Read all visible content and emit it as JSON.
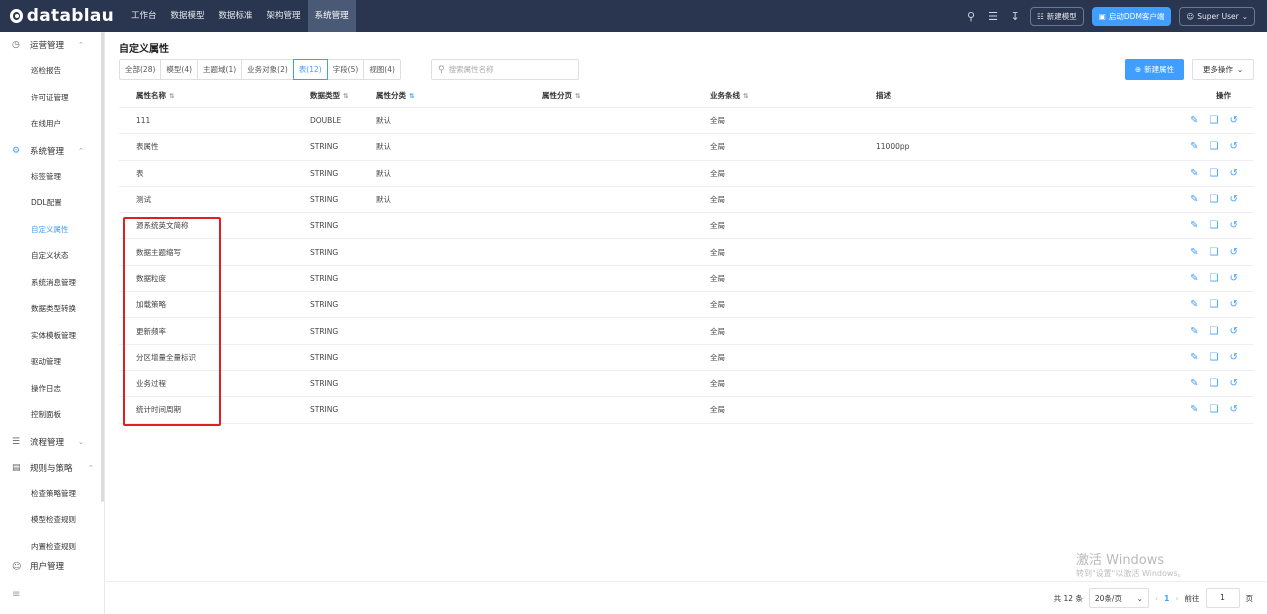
{
  "app": {
    "logo": "datablau"
  },
  "nav": {
    "items": [
      "工作台",
      "数据模型",
      "数据标准",
      "架构管理",
      "系统管理"
    ],
    "active": 4,
    "actions": {
      "new_model": "新建模型",
      "launch_client": "启动DDM客户端",
      "user": "Super User"
    }
  },
  "sidebar": {
    "group1": "运营管理",
    "group1_items": [
      "巡检报告",
      "许可证管理",
      "在线用户"
    ],
    "group2": "系统管理",
    "group2_items": [
      "标签管理",
      "DDL配置",
      "自定义属性",
      "自定义状态",
      "系统消息管理",
      "数据类型转换",
      "实体模板管理",
      "驱动管理",
      "操作日志",
      "控制面板"
    ],
    "active_item": "自定义属性",
    "group3": "流程管理",
    "group4": "规则与策略",
    "group4_items": [
      "检查策略管理",
      "模型检查规则",
      "内置检查规则"
    ],
    "group5": "用户管理"
  },
  "page": {
    "title": "自定义属性"
  },
  "tabs": [
    "全部(28)",
    "模型(4)",
    "主题域(1)",
    "业务对象(2)",
    "表(12)",
    "字段(5)",
    "视图(4)"
  ],
  "active_tab": 4,
  "search": {
    "placeholder": "搜索属性名称",
    "value": ""
  },
  "buttons": {
    "new": "新建属性",
    "more": "更多操作"
  },
  "table": {
    "headers": [
      "属性名称",
      "数据类型",
      "属性分类",
      "属性分页",
      "业务条线",
      "描述",
      "操作"
    ],
    "rows": [
      [
        "111",
        "DOUBLE",
        "默认",
        "",
        "全局",
        ""
      ],
      [
        "表属性",
        "STRING",
        "默认",
        "",
        "全局",
        "11000pp"
      ],
      [
        "表",
        "STRING",
        "默认",
        "",
        "全局",
        ""
      ],
      [
        "测试",
        "STRING",
        "默认",
        "",
        "全局",
        ""
      ],
      [
        "源系统英文简称",
        "STRING",
        "",
        "",
        "全局",
        ""
      ],
      [
        "数据主题缩写",
        "STRING",
        "",
        "",
        "全局",
        ""
      ],
      [
        "数据粒度",
        "STRING",
        "",
        "",
        "全局",
        ""
      ],
      [
        "加载策略",
        "STRING",
        "",
        "",
        "全局",
        ""
      ],
      [
        "更新频率",
        "STRING",
        "",
        "",
        "全局",
        ""
      ],
      [
        "分区增量全量标识",
        "STRING",
        "",
        "",
        "全局",
        ""
      ],
      [
        "业务过程",
        "STRING",
        "",
        "",
        "全局",
        ""
      ],
      [
        "统计时间周期",
        "STRING",
        "",
        "",
        "全局",
        ""
      ]
    ]
  },
  "watermark": {
    "line1": "激活 Windows",
    "line2": "转到\"设置\"以激活 Windows。"
  },
  "pagination": {
    "total": "共 12 条",
    "page_size": "20条/页",
    "current": "1",
    "goto_label": "前往",
    "goto_value": "1",
    "page_suffix": "页"
  },
  "colors": {
    "topbar": "#2a3650",
    "accent": "#409eff",
    "highlight": "#e02020"
  }
}
